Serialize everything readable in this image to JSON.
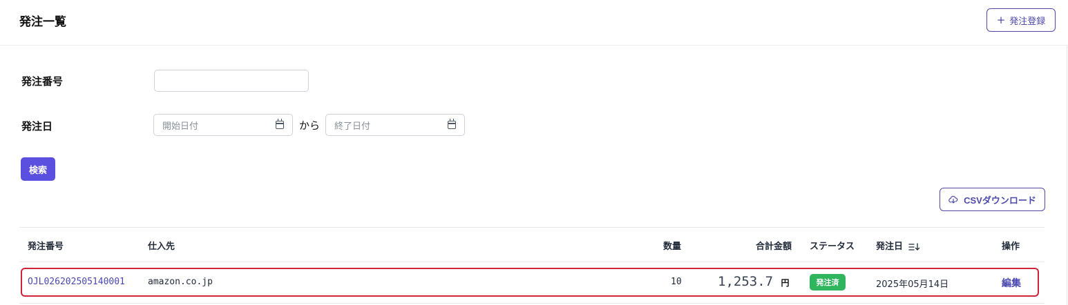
{
  "header": {
    "title": "発注一覧",
    "add_label": "発注登録",
    "add_icon": "plus-icon"
  },
  "filters": {
    "order_number_label": "発注番号",
    "order_number_value": "",
    "order_date_label": "発注日",
    "start_placeholder": "開始日付",
    "end_placeholder": "終了日付",
    "range_separator": "から",
    "search_label": "検索"
  },
  "csv": {
    "label": "CSVダウンロード",
    "icon": "cloud-download-icon"
  },
  "table": {
    "columns": {
      "order_number": "発注番号",
      "supplier": "仕入先",
      "quantity": "数量",
      "total": "合計金額",
      "status": "ステータス",
      "order_date": "発注日",
      "actions": "操作"
    },
    "sort_icon": "sort-descending-icon",
    "rows": [
      {
        "order_number": "OJL026202505140001",
        "supplier": "amazon.co.jp",
        "quantity": "10",
        "total": "1,253.7",
        "currency": "円",
        "status": "発注済",
        "order_date": "2025年05月14日",
        "action": "編集"
      }
    ]
  },
  "colors": {
    "accent": "#5b4fe0",
    "link": "#4a47b0",
    "status_green": "#2fb55d",
    "highlight_red": "#d0213a"
  }
}
